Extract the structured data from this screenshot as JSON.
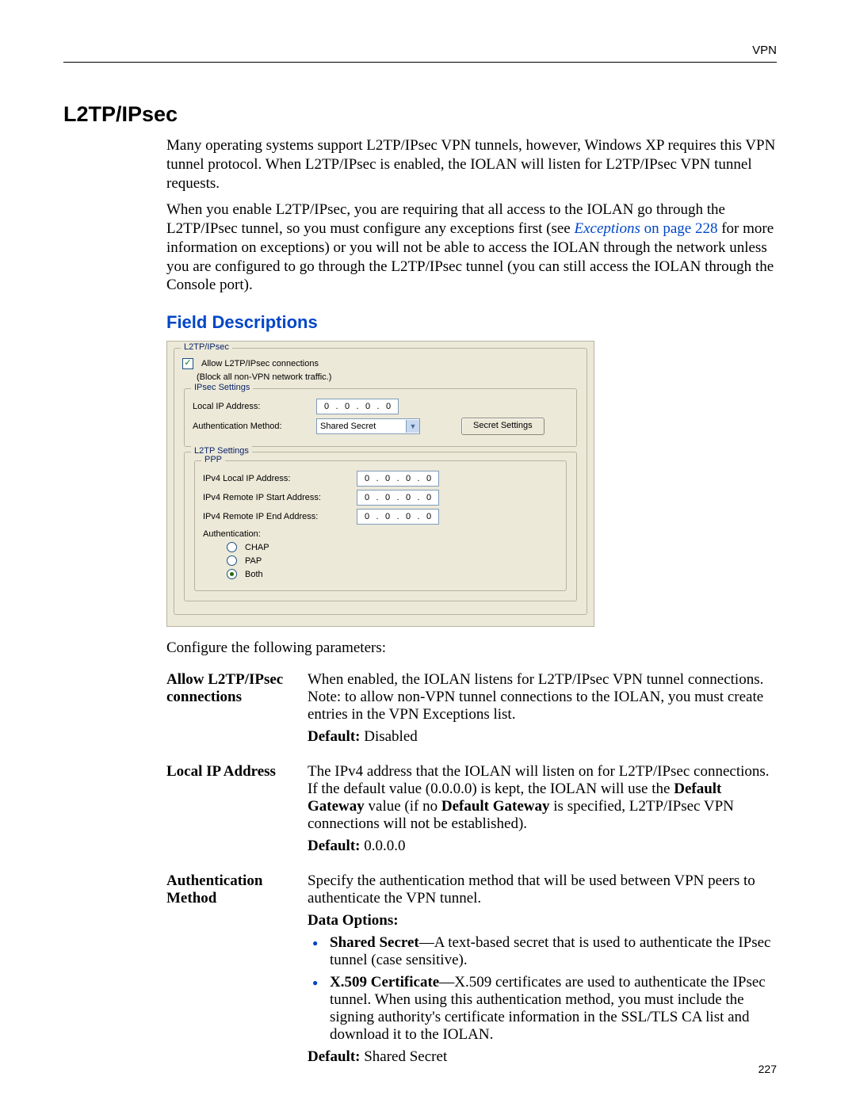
{
  "header": {
    "right": "VPN"
  },
  "title": "L2TP/IPsec",
  "intro": {
    "p1": "Many operating systems support L2TP/IPsec VPN tunnels, however, Windows XP requires this VPN tunnel protocol. When L2TP/IPsec is enabled, the IOLAN will listen for L2TP/IPsec VPN tunnel requests.",
    "p2a": "When you enable L2TP/IPsec, you are requiring that all access to the IOLAN go through the L2TP/IPsec tunnel, so you must configure any exceptions first (see ",
    "xref_text": "Exceptions",
    "xref_page": " on page 228",
    "p2b": " for more information on exceptions) or you will not be able to access the IOLAN through the network unless you are configured to go through the L2TP/IPsec tunnel (you can still access the IOLAN through the Console port)."
  },
  "sub_title": "Field Descriptions",
  "dialog": {
    "group_main": "L2TP/IPsec",
    "allow_label": "Allow L2TP/IPsec connections",
    "allow_note": "(Block all non-VPN network traffic.)",
    "ipsec_legend": "IPsec Settings",
    "local_ip_label": "Local IP Address:",
    "auth_method_label": "Authentication Method:",
    "auth_method_value": "Shared Secret",
    "secret_btn": "Secret Settings",
    "l2tp_legend": "L2TP Settings",
    "ppp_legend": "PPP",
    "ipv4_local_label": "IPv4 Local IP Address:",
    "ipv4_start_label": "IPv4 Remote IP Start Address:",
    "ipv4_end_label": "IPv4 Remote IP End Address:",
    "auth_label": "Authentication:",
    "chap": "CHAP",
    "pap": "PAP",
    "both": "Both",
    "ip": {
      "o1": "0",
      "o2": "0",
      "o3": "0",
      "o4": "0"
    }
  },
  "config_intro": "Configure the following parameters:",
  "fields": {
    "allow": {
      "term": "Allow L2TP/IPsec connections",
      "desc": "When enabled, the IOLAN listens for L2TP/IPsec VPN tunnel connections. Note: to allow non-VPN tunnel connections to the IOLAN, you must create entries in the VPN Exceptions list.",
      "default_label": "Default:",
      "default_value": " Disabled"
    },
    "localip": {
      "term": "Local IP Address",
      "desc_a": "The IPv4 address that the IOLAN will listen on for L2TP/IPsec connections. If the default value (0.0.0.0) is kept, the IOLAN will use the ",
      "desc_bold1": "Default Gateway",
      "desc_b": " value (if no ",
      "desc_bold2": "Default Gateway",
      "desc_c": " is specified, L2TP/IPsec VPN connections will not be established).",
      "default_label": "Default:",
      "default_value": " 0.0.0.0"
    },
    "auth": {
      "term": "Authentication Method",
      "desc": "Specify the authentication method that will be used between VPN peers to authenticate the VPN tunnel.",
      "options_label": "Data Options:",
      "opt1_bold": "Shared Secret",
      "opt1_text": "—A text-based secret that is used to authenticate the IPsec tunnel (case sensitive).",
      "opt2_bold": "X.509 Certificate",
      "opt2_text": "—X.509 certificates are used to authenticate the IPsec tunnel. When using this authentication method, you must include the signing authority's certificate information in the SSL/TLS CA list and download it to the IOLAN.",
      "default_label": "Default:",
      "default_value": " Shared Secret"
    }
  },
  "page_number": "227"
}
